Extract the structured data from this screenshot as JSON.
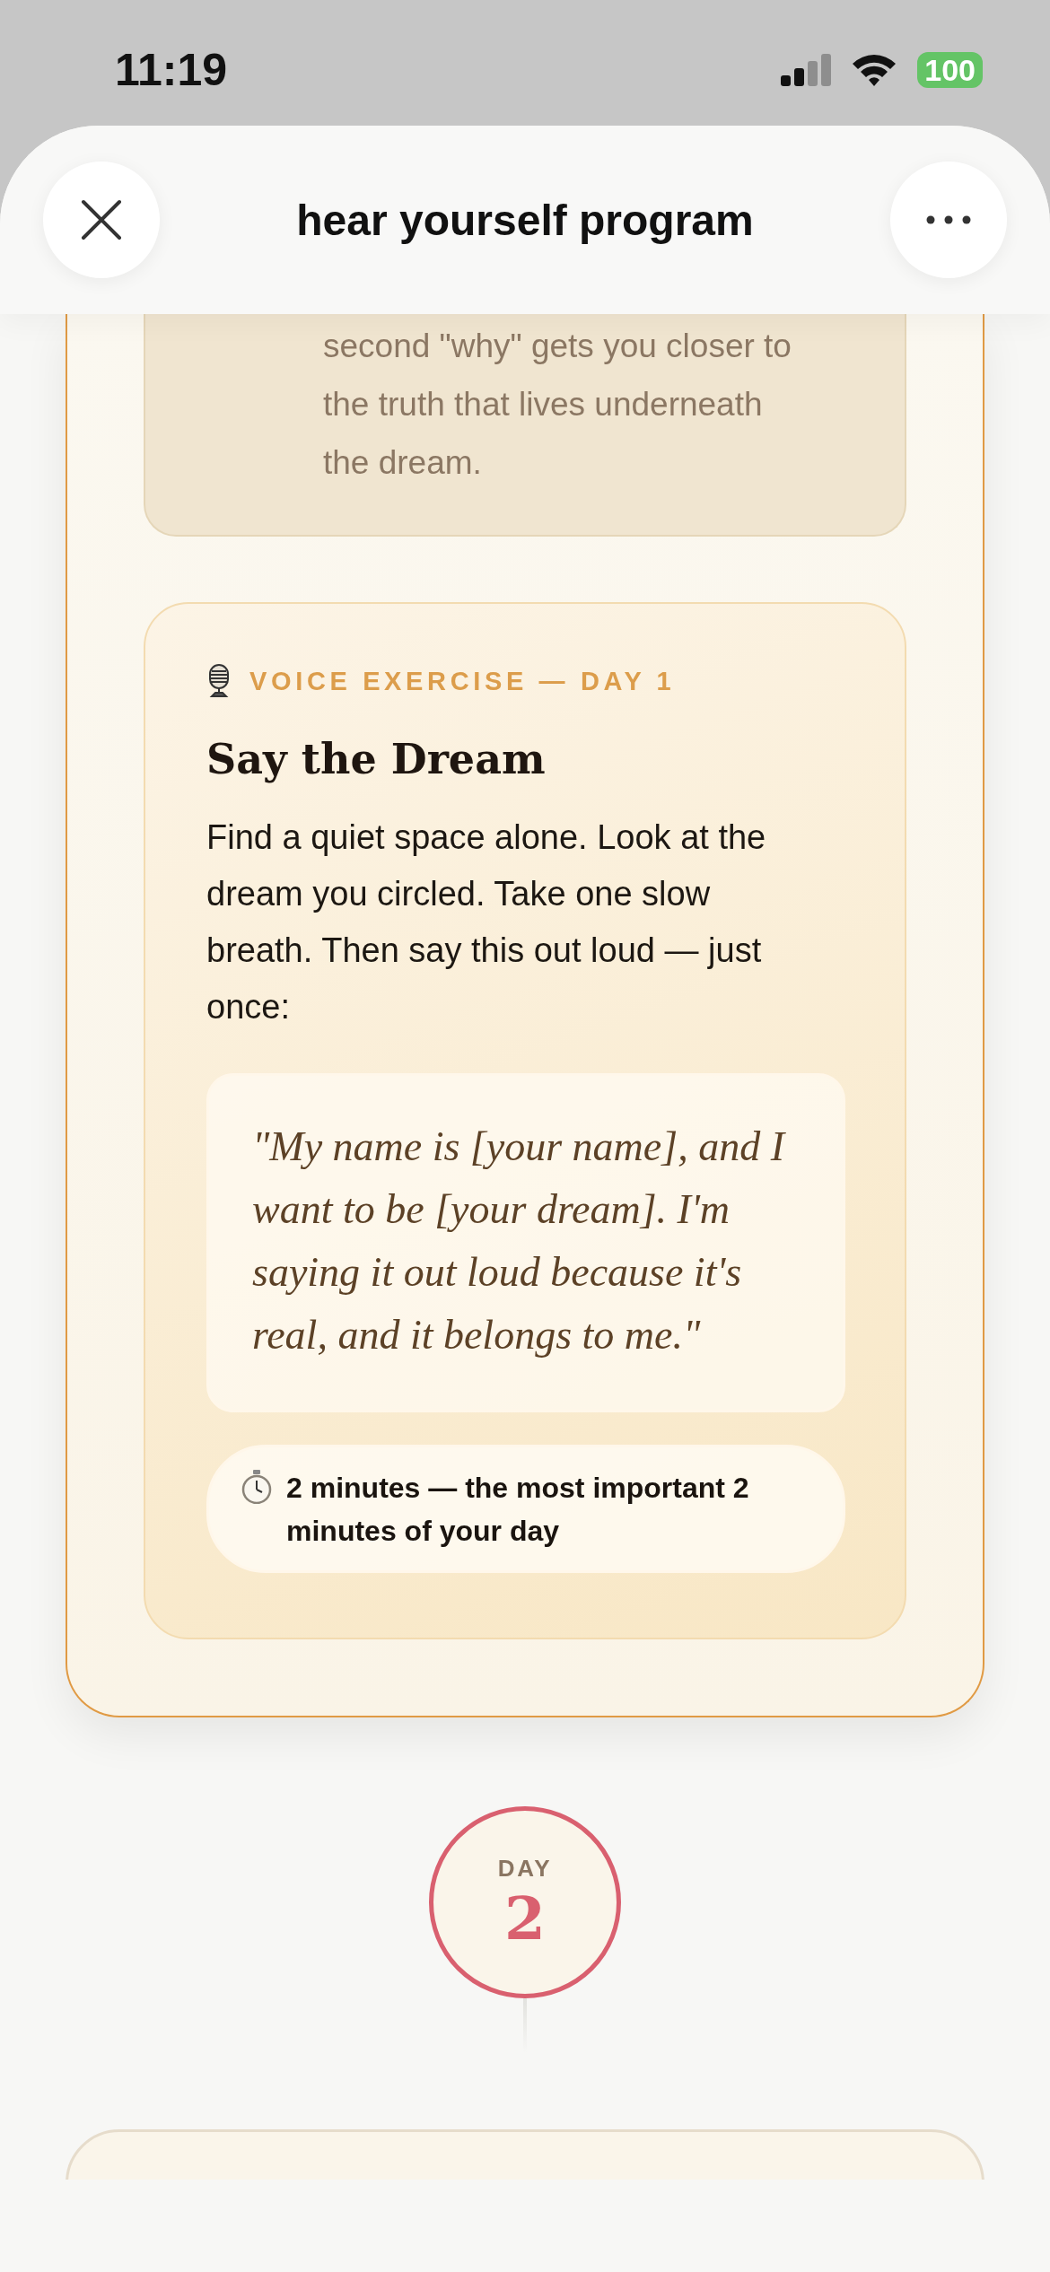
{
  "status_bar": {
    "time": "11:19",
    "battery": "100"
  },
  "header": {
    "title": "hear yourself program"
  },
  "note_card": {
    "text": "second \"why\" gets you closer to the truth that lives underneath the dream."
  },
  "voice_exercise": {
    "label": "VOICE EXERCISE — DAY 1",
    "title": "Say the Dream",
    "body": "Find a quiet space alone. Look at the dream you circled. Take one slow breath. Then say this out loud — just once:",
    "quote": "\"My name is [your name], and I want to be [your dream]. I'm saying it out loud because it's real, and it belongs to me.\"",
    "timer": "2 minutes — the most important 2 minutes of your day"
  },
  "day_marker": {
    "label": "DAY",
    "number": "2"
  }
}
